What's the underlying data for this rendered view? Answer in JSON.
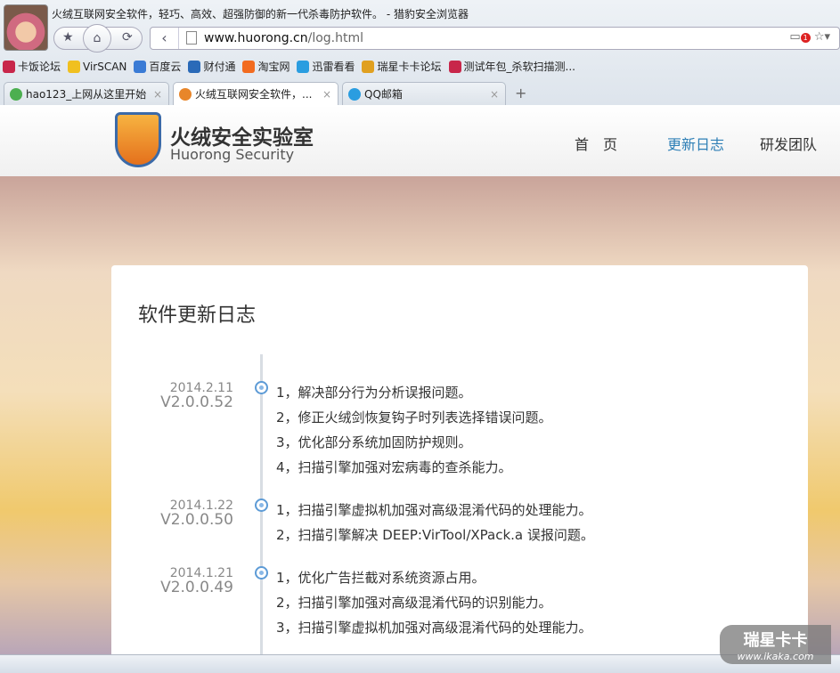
{
  "browser": {
    "window_title": "火绒互联网安全软件，轻巧、高效、超强防御的新一代杀毒防护软件。 - 猎豹安全浏览器",
    "url_domain": "www.huorong.cn",
    "url_path": "/log.html",
    "notif_count": "1",
    "bookmarks": [
      {
        "label": "卡饭论坛",
        "color": "#c8264a"
      },
      {
        "label": "VirSCAN",
        "color": "#f0c020"
      },
      {
        "label": "百度云",
        "color": "#3a7bd5"
      },
      {
        "label": "财付通",
        "color": "#2a6ab8"
      },
      {
        "label": "淘宝网",
        "color": "#f26b1f"
      },
      {
        "label": "迅雷看看",
        "color": "#2a9de0"
      },
      {
        "label": "瑞星卡卡论坛",
        "color": "#e0a020"
      },
      {
        "label": "测试年包_杀软扫描测...",
        "color": "#c8264a"
      }
    ],
    "tabs": [
      {
        "label": "hao123_上网从这里开始",
        "color": "#4caf50"
      },
      {
        "label": "火绒互联网安全软件，...",
        "color": "#e8862a"
      },
      {
        "label": "QQ邮箱",
        "color": "#2a9de0"
      }
    ]
  },
  "site": {
    "brand_cn": "火绒安全实验室",
    "brand_en": "Huorong Security",
    "nav": [
      {
        "label": "首　页"
      },
      {
        "label": "更新日志",
        "active": true
      },
      {
        "label": "研发团队"
      }
    ],
    "active_color": "#2e7fb6",
    "page_title": "软件更新日志",
    "entries": [
      {
        "date": "2014.2.11",
        "version": "V2.0.0.52",
        "items": [
          "1，解决部分行为分析误报问题。",
          "2，修正火绒剑恢复钩子时列表选择错误问题。",
          "3，优化部分系统加固防护规则。",
          "4，扫描引擎加强对宏病毒的查杀能力。"
        ]
      },
      {
        "date": "2014.1.22",
        "version": "V2.0.0.50",
        "items": [
          "1，扫描引擎虚拟机加强对高级混淆代码的处理能力。",
          "2，扫描引擎解决 DEEP:VirTool/XPack.a 误报问题。"
        ]
      },
      {
        "date": "2014.1.21",
        "version": "V2.0.0.49",
        "items": [
          "1，优化广告拦截对系统资源占用。",
          "2，扫描引擎加强对高级混淆代码的识别能力。",
          "3，扫描引擎虚拟机加强对高级混淆代码的处理能力。"
        ]
      }
    ]
  },
  "watermark": {
    "title": "瑞星卡卡",
    "url": "www.ikaka.com"
  }
}
